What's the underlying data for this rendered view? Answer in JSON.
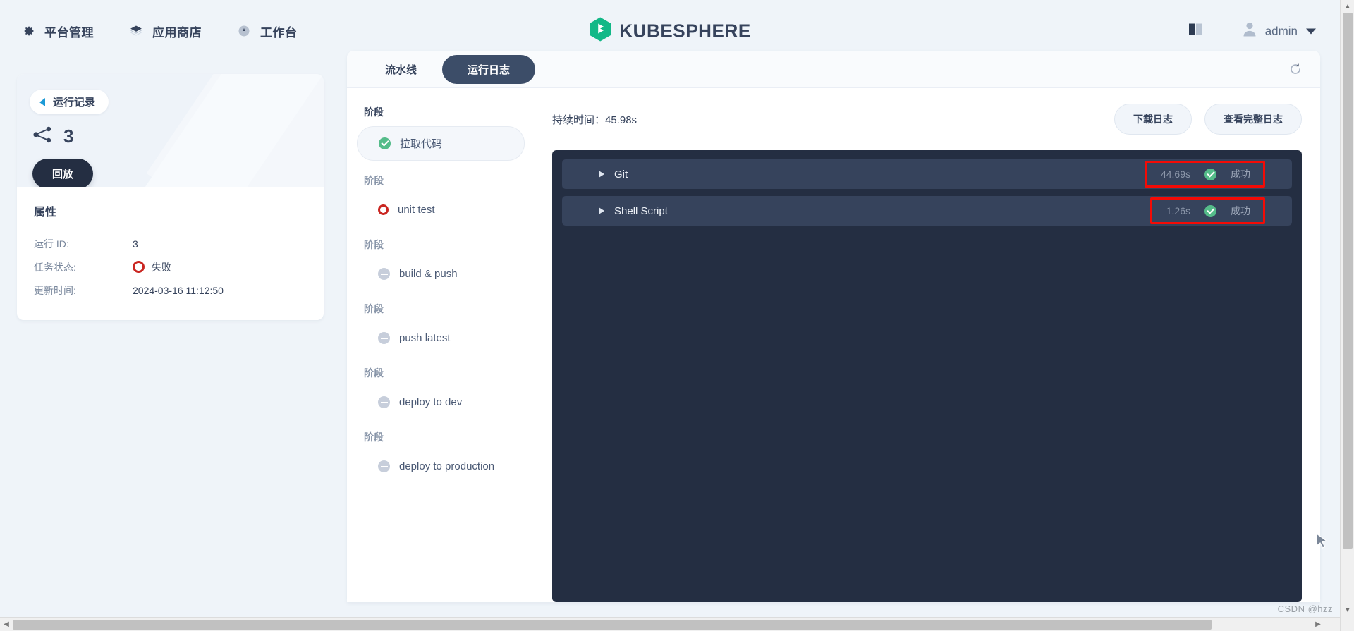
{
  "header": {
    "nav": [
      {
        "label": "平台管理",
        "icon": "gear-icon"
      },
      {
        "label": "应用商店",
        "icon": "layers-icon"
      },
      {
        "label": "工作台",
        "icon": "dashboard-icon"
      }
    ],
    "brand": "KUBESPHERE",
    "brand_color": "#12B887",
    "docs_icon": "book-icon",
    "user": "admin"
  },
  "detail": {
    "back_label": "运行记录",
    "run_number": "3",
    "replay_label": "回放",
    "attributes_title": "属性",
    "attributes": [
      {
        "key": "运行 ID:",
        "value": "3",
        "status": null
      },
      {
        "key": "任务状态:",
        "value": "失败",
        "status": "fail"
      },
      {
        "key": "更新时间:",
        "value": "2024-03-16 11:12:50",
        "status": null
      }
    ]
  },
  "main": {
    "tabs": [
      {
        "label": "流水线",
        "active": false
      },
      {
        "label": "运行日志",
        "active": true
      }
    ],
    "refresh_icon": "refresh-icon",
    "stages": [
      {
        "group_label": "阶段",
        "name": "拉取代码",
        "status": "success",
        "selected": true
      },
      {
        "group_label": "阶段",
        "name": "unit test",
        "status": "fail",
        "selected": false
      },
      {
        "group_label": "阶段",
        "name": "build & push",
        "status": "pending",
        "selected": false
      },
      {
        "group_label": "阶段",
        "name": "push latest",
        "status": "pending",
        "selected": false
      },
      {
        "group_label": "阶段",
        "name": "deploy to dev",
        "status": "pending",
        "selected": false
      },
      {
        "group_label": "阶段",
        "name": "deploy to production",
        "status": "pending",
        "selected": false
      }
    ],
    "duration_text": "持续时间：45.98s",
    "actions": [
      {
        "label": "下载日志"
      },
      {
        "label": "查看完整日志"
      }
    ],
    "log_rows": [
      {
        "name": "Git",
        "time": "44.69s",
        "status": "成功",
        "highlight": true
      },
      {
        "name": "Shell Script",
        "time": "1.26s",
        "status": "成功",
        "highlight": true
      }
    ],
    "highlight_color": "#F40B06"
  },
  "watermark": "CSDN @hzz"
}
